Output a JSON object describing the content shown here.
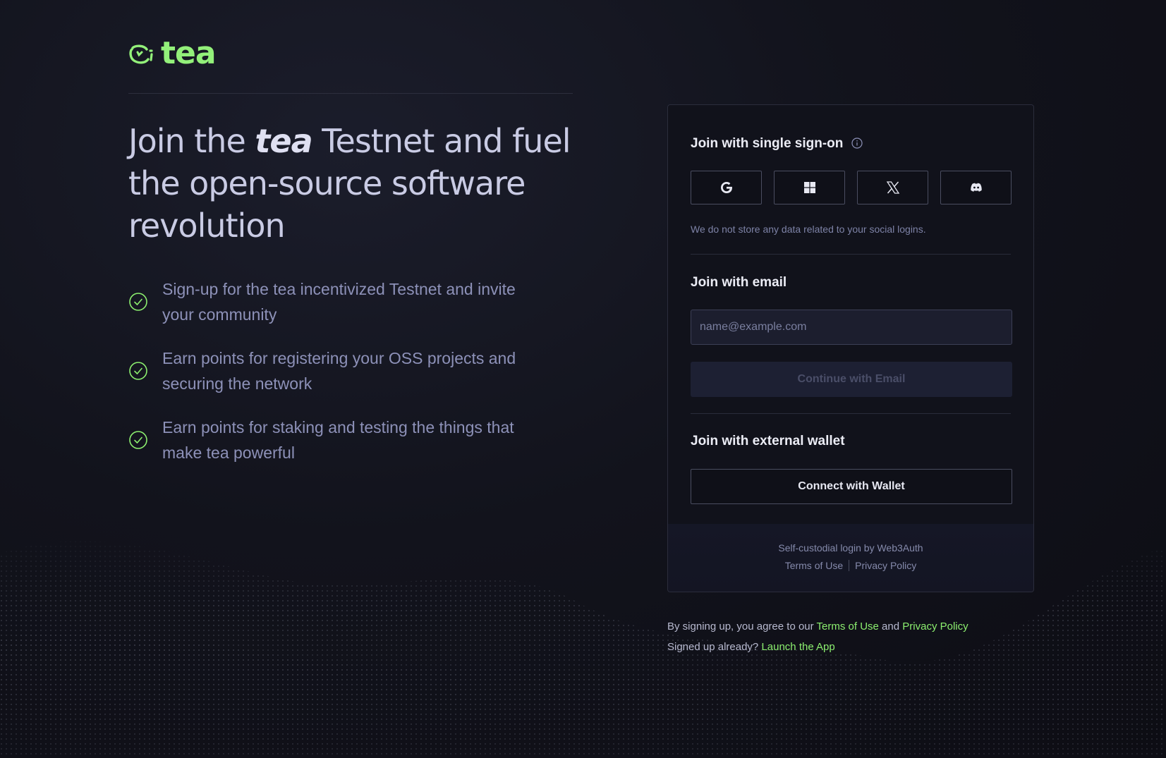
{
  "brand": {
    "name": "tea",
    "accent": "#93f07a"
  },
  "hero": {
    "title_part1": "Join the ",
    "title_emphasis": "tea",
    "title_part2": " Testnet and fuel the open-source software revolution"
  },
  "features": [
    {
      "icon": "check-circle-icon",
      "text": "Sign-up for the tea incentivized Testnet and invite your community"
    },
    {
      "icon": "check-circle-icon",
      "text": "Earn points for registering your OSS projects and securing the network"
    },
    {
      "icon": "check-circle-icon",
      "text": "Earn points for staking and testing the things that make tea powerful"
    }
  ],
  "card": {
    "sso_title": "Join with single sign-on",
    "sso_providers": [
      {
        "name": "Google",
        "icon": "google-icon"
      },
      {
        "name": "Windows",
        "icon": "windows-icon"
      },
      {
        "name": "X",
        "icon": "x-icon"
      },
      {
        "name": "Discord",
        "icon": "discord-icon"
      }
    ],
    "sso_note": "We do not store any data related to your social logins.",
    "email_title": "Join with email",
    "email_placeholder": "name@example.com",
    "email_value": "",
    "continue_label": "Continue with Email",
    "wallet_title": "Join with external wallet",
    "wallet_label": "Connect with Wallet",
    "footer_powered": "Self-custodial login by Web3Auth",
    "footer_terms": "Terms of Use",
    "footer_privacy": "Privacy Policy"
  },
  "legal": {
    "agree_prefix": "By signing up, you agree to our ",
    "terms_link": "Terms of Use",
    "and": " and ",
    "privacy_link": "Privacy Policy",
    "signed_up_prefix": "Signed up already? ",
    "launch_link": "Launch the App"
  }
}
